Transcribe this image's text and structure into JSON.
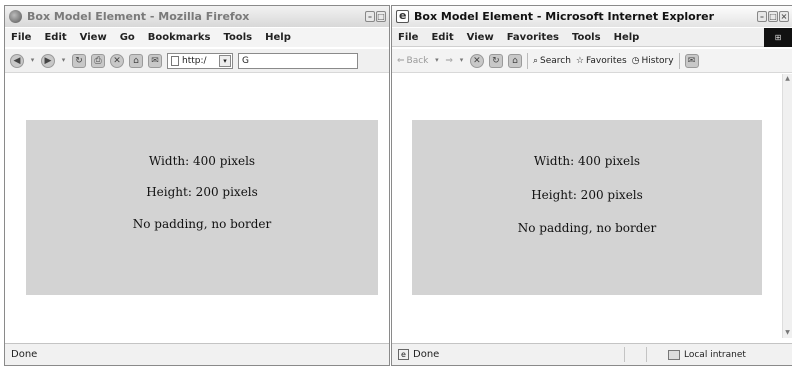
{
  "firefox": {
    "title": "Box Model Element - Mozilla Firefox",
    "menu": [
      "File",
      "Edit",
      "View",
      "Go",
      "Bookmarks",
      "Tools",
      "Help"
    ],
    "address": "http:/",
    "search_value": "G",
    "box": {
      "width_text": "Width: 400 pixels",
      "height_text": "Height: 200 pixels",
      "note_text": "No padding, no border"
    },
    "status": "Done"
  },
  "ie": {
    "title": "Box Model Element - Microsoft Internet Explorer",
    "menu": [
      "File",
      "Edit",
      "View",
      "Favorites",
      "Tools",
      "Help"
    ],
    "toolbar": {
      "back": "Back",
      "search": "Search",
      "favorites": "Favorites",
      "history": "History"
    },
    "box": {
      "width_text": "Width: 400 pixels",
      "height_text": "Height: 200 pixels",
      "note_text": "No padding, no border"
    },
    "status": "Done",
    "zone": "Local intranet"
  },
  "colors": {
    "box_fill": "#d3d3d3",
    "window_border": "#8a8a8a"
  }
}
